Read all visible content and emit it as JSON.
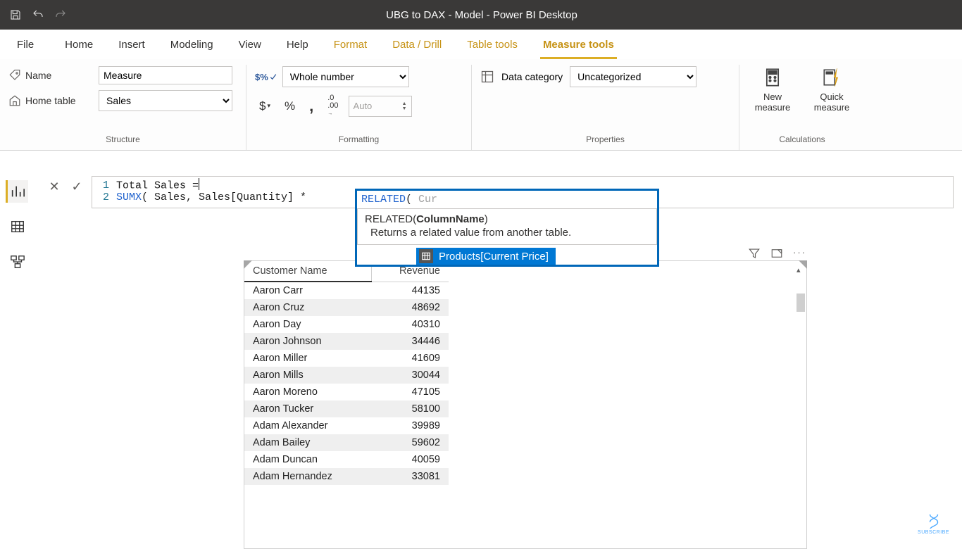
{
  "titlebar": {
    "title": "UBG to DAX - Model - Power BI Desktop"
  },
  "tabs": {
    "file": "File",
    "home": "Home",
    "insert": "Insert",
    "modeling": "Modeling",
    "view": "View",
    "help": "Help",
    "format": "Format",
    "datadrill": "Data / Drill",
    "tabletools": "Table tools",
    "measuretools": "Measure tools"
  },
  "structure": {
    "group_label": "Structure",
    "name_label": "Name",
    "name_value": "Measure",
    "home_table_label": "Home table",
    "home_table_value": "Sales"
  },
  "formatting": {
    "group_label": "Formatting",
    "format_value": "Whole number",
    "currency": "$",
    "percent": "%",
    "thousands": ",",
    "decimals_icon": ".00",
    "auto_placeholder": "Auto"
  },
  "properties": {
    "group_label": "Properties",
    "data_category_label": "Data category",
    "data_category_value": "Uncategorized"
  },
  "calculations": {
    "group_label": "Calculations",
    "new_measure": "New measure",
    "quick_measure": "Quick measure"
  },
  "formula": {
    "line1_num": "1",
    "line2_num": "2",
    "line1": "Total Sales =",
    "l2_func": "SUMX",
    "l2_rest": "( Sales, Sales[Quantity] * ",
    "l2_rel_func": "RELATED",
    "l2_rel_paren": "( ",
    "l2_typed": "Cur"
  },
  "intelli": {
    "sig_pre": "RELATED(",
    "sig_bold": "ColumnName",
    "sig_post": ")",
    "desc": "Returns a related value from another table.",
    "suggestion": "Products[Current Price]"
  },
  "table": {
    "col1": "Customer Name",
    "col2": "Revenue",
    "rows": [
      {
        "name": "Aaron Carr",
        "rev": "44135"
      },
      {
        "name": "Aaron Cruz",
        "rev": "48692"
      },
      {
        "name": "Aaron Day",
        "rev": "40310"
      },
      {
        "name": "Aaron Johnson",
        "rev": "34446"
      },
      {
        "name": "Aaron Miller",
        "rev": "41609"
      },
      {
        "name": "Aaron Mills",
        "rev": "30044"
      },
      {
        "name": "Aaron Moreno",
        "rev": "47105"
      },
      {
        "name": "Aaron Tucker",
        "rev": "58100"
      },
      {
        "name": "Adam Alexander",
        "rev": "39989"
      },
      {
        "name": "Adam Bailey",
        "rev": "59602"
      },
      {
        "name": "Adam Duncan",
        "rev": "40059"
      },
      {
        "name": "Adam Hernandez",
        "rev": "33081"
      }
    ]
  },
  "subscribe": "SUBSCRIBE"
}
